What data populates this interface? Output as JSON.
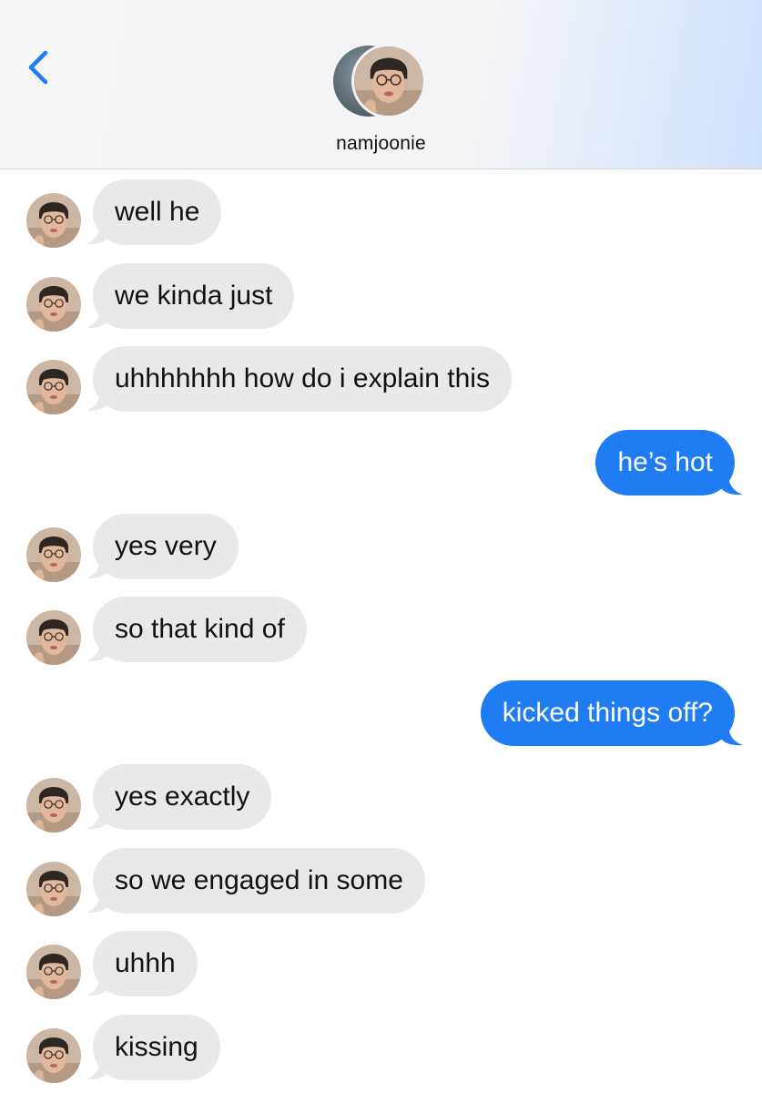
{
  "header": {
    "back_icon": "chevron-left-icon",
    "contact_name": "namjoonie"
  },
  "colors": {
    "sent_bubble": "#1f7cf2",
    "received_bubble": "#e9e9eb",
    "back_chevron": "#1f7cf2"
  },
  "messages": [
    {
      "direction": "received",
      "text": "well he"
    },
    {
      "direction": "received",
      "text": "we kinda just"
    },
    {
      "direction": "received",
      "text": "uhhhhhhh how do i explain this"
    },
    {
      "direction": "sent",
      "text": "he’s hot"
    },
    {
      "direction": "received",
      "text": "yes very"
    },
    {
      "direction": "received",
      "text": "so that kind of"
    },
    {
      "direction": "sent",
      "text": "kicked things off?"
    },
    {
      "direction": "received",
      "text": "yes exactly"
    },
    {
      "direction": "received",
      "text": "so we engaged in some"
    },
    {
      "direction": "received",
      "text": "uhhh"
    },
    {
      "direction": "received",
      "text": "kissing"
    }
  ]
}
